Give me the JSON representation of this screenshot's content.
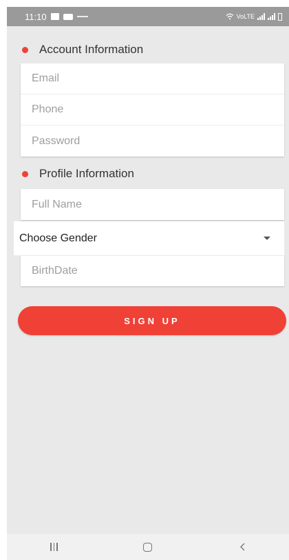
{
  "status_bar": {
    "time": "11:10",
    "network_text": "VoLTE"
  },
  "account_section": {
    "title": "Account Information"
  },
  "account_fields": [
    {
      "placeholder": "Email",
      "value": ""
    },
    {
      "placeholder": "Phone",
      "value": ""
    },
    {
      "placeholder": "Password",
      "value": ""
    }
  ],
  "profile_section": {
    "title": "Profile Information"
  },
  "profile_fields": {
    "full_name": {
      "placeholder": "Full Name",
      "value": ""
    },
    "gender": {
      "selected": "Choose Gender"
    },
    "birthdate": {
      "placeholder": "BirthDate",
      "value": ""
    }
  },
  "signup_button": {
    "label": "SIGN UP"
  },
  "colors": {
    "accent": "#ef4136",
    "background": "#e9e9e9",
    "status_bar": "#9a9a9a"
  },
  "icons": {
    "nav_recent": "recent-apps-icon",
    "nav_home": "home-icon",
    "nav_back": "back-icon",
    "caret": "chevron-down-icon"
  }
}
